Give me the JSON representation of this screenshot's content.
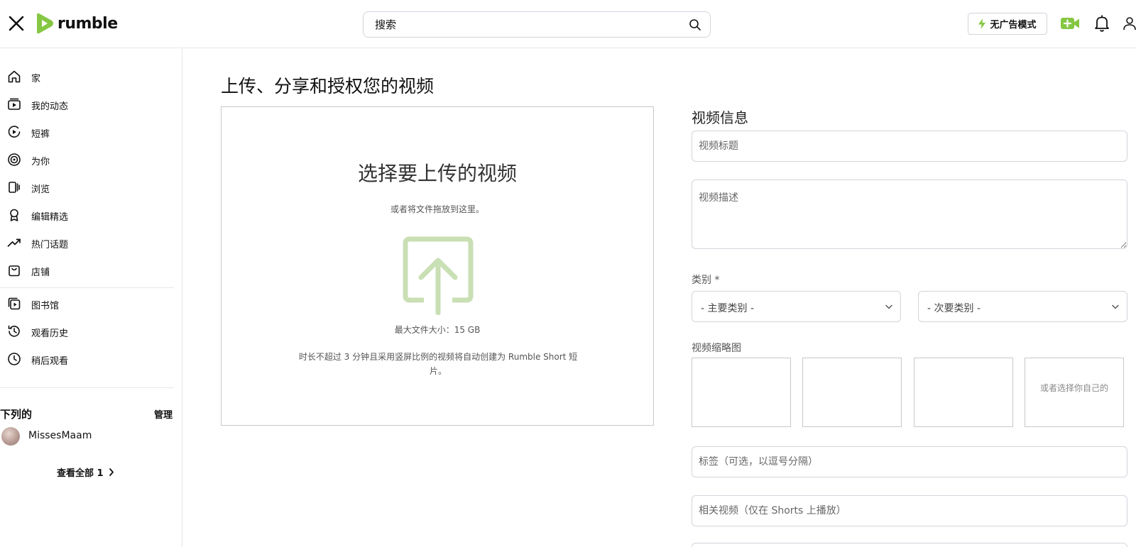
{
  "header": {
    "logo_text": "rumble",
    "search_placeholder": "搜索",
    "adfree_label": "无广告模式"
  },
  "sidebar": {
    "nav": [
      {
        "label": "家",
        "icon": "home-icon"
      },
      {
        "label": "我的动态",
        "icon": "feed-icon"
      },
      {
        "label": "短裤",
        "icon": "shorts-icon"
      },
      {
        "label": "为你",
        "icon": "target-icon"
      },
      {
        "label": "浏览",
        "icon": "browse-icon"
      },
      {
        "label": "编辑精选",
        "icon": "award-icon"
      },
      {
        "label": "热门话题",
        "icon": "trending-icon"
      },
      {
        "label": "店铺",
        "icon": "shop-icon"
      }
    ],
    "library": [
      {
        "label": "图书馆",
        "icon": "library-icon"
      },
      {
        "label": "观看历史",
        "icon": "history-icon"
      },
      {
        "label": "稍后观看",
        "icon": "clock-icon"
      }
    ],
    "subscriptions": {
      "title": "下列的",
      "manage_label": "管理",
      "items": [
        {
          "name": "MissesMaam"
        }
      ],
      "see_all_label": "查看全部 1"
    }
  },
  "main": {
    "page_title": "上传、分享和授权您的视频",
    "dropzone": {
      "title": "选择要上传的视频",
      "subtitle": "或者将文件拖放到这里。",
      "max_size": "最大文件大小：15 GB",
      "note": "时长不超过 3 分钟且采用竖屏比例的视频将自动创建为 Rumble Short 短片。"
    },
    "form": {
      "section_title": "视频信息",
      "title_placeholder": "视频标题",
      "description_placeholder": "视频描述",
      "category_label": "类别 *",
      "primary_category": "- 主要类别 -",
      "secondary_category": "- 次要类别 -",
      "thumbnail_label": "视频缩略图",
      "custom_thumbnail_text": "或者选择你自己的",
      "tags_placeholder": "标签（可选，以逗号分隔）",
      "related_placeholder": "相关视频（仅在 Shorts 上播放）"
    }
  },
  "colors": {
    "brand": "#85c742",
    "upload_icon": "#c9dfb4"
  }
}
